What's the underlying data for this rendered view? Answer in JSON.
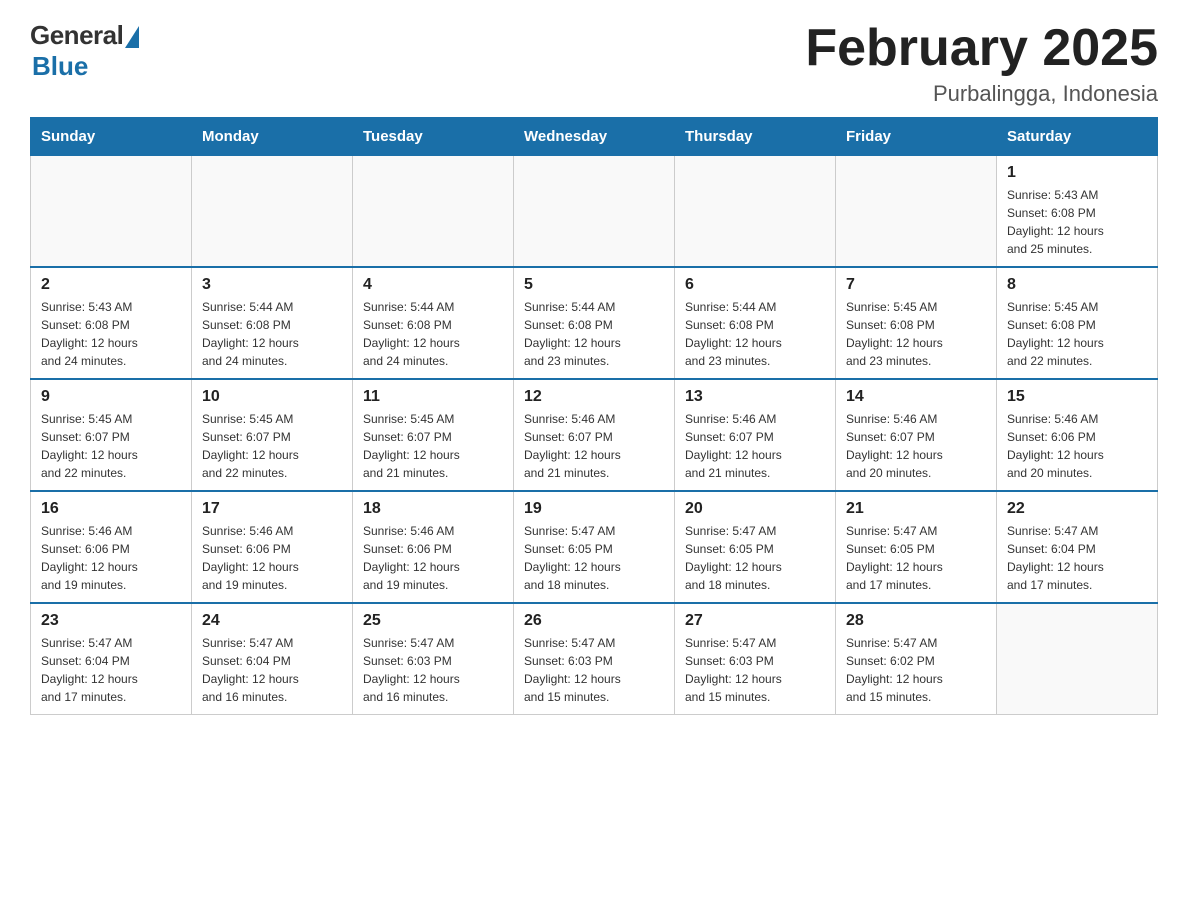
{
  "header": {
    "logo_general": "General",
    "logo_blue": "Blue",
    "title": "February 2025",
    "subtitle": "Purbalingga, Indonesia"
  },
  "weekdays": [
    "Sunday",
    "Monday",
    "Tuesday",
    "Wednesday",
    "Thursday",
    "Friday",
    "Saturday"
  ],
  "weeks": [
    [
      {
        "day": "",
        "info": ""
      },
      {
        "day": "",
        "info": ""
      },
      {
        "day": "",
        "info": ""
      },
      {
        "day": "",
        "info": ""
      },
      {
        "day": "",
        "info": ""
      },
      {
        "day": "",
        "info": ""
      },
      {
        "day": "1",
        "info": "Sunrise: 5:43 AM\nSunset: 6:08 PM\nDaylight: 12 hours\nand 25 minutes."
      }
    ],
    [
      {
        "day": "2",
        "info": "Sunrise: 5:43 AM\nSunset: 6:08 PM\nDaylight: 12 hours\nand 24 minutes."
      },
      {
        "day": "3",
        "info": "Sunrise: 5:44 AM\nSunset: 6:08 PM\nDaylight: 12 hours\nand 24 minutes."
      },
      {
        "day": "4",
        "info": "Sunrise: 5:44 AM\nSunset: 6:08 PM\nDaylight: 12 hours\nand 24 minutes."
      },
      {
        "day": "5",
        "info": "Sunrise: 5:44 AM\nSunset: 6:08 PM\nDaylight: 12 hours\nand 23 minutes."
      },
      {
        "day": "6",
        "info": "Sunrise: 5:44 AM\nSunset: 6:08 PM\nDaylight: 12 hours\nand 23 minutes."
      },
      {
        "day": "7",
        "info": "Sunrise: 5:45 AM\nSunset: 6:08 PM\nDaylight: 12 hours\nand 23 minutes."
      },
      {
        "day": "8",
        "info": "Sunrise: 5:45 AM\nSunset: 6:08 PM\nDaylight: 12 hours\nand 22 minutes."
      }
    ],
    [
      {
        "day": "9",
        "info": "Sunrise: 5:45 AM\nSunset: 6:07 PM\nDaylight: 12 hours\nand 22 minutes."
      },
      {
        "day": "10",
        "info": "Sunrise: 5:45 AM\nSunset: 6:07 PM\nDaylight: 12 hours\nand 22 minutes."
      },
      {
        "day": "11",
        "info": "Sunrise: 5:45 AM\nSunset: 6:07 PM\nDaylight: 12 hours\nand 21 minutes."
      },
      {
        "day": "12",
        "info": "Sunrise: 5:46 AM\nSunset: 6:07 PM\nDaylight: 12 hours\nand 21 minutes."
      },
      {
        "day": "13",
        "info": "Sunrise: 5:46 AM\nSunset: 6:07 PM\nDaylight: 12 hours\nand 21 minutes."
      },
      {
        "day": "14",
        "info": "Sunrise: 5:46 AM\nSunset: 6:07 PM\nDaylight: 12 hours\nand 20 minutes."
      },
      {
        "day": "15",
        "info": "Sunrise: 5:46 AM\nSunset: 6:06 PM\nDaylight: 12 hours\nand 20 minutes."
      }
    ],
    [
      {
        "day": "16",
        "info": "Sunrise: 5:46 AM\nSunset: 6:06 PM\nDaylight: 12 hours\nand 19 minutes."
      },
      {
        "day": "17",
        "info": "Sunrise: 5:46 AM\nSunset: 6:06 PM\nDaylight: 12 hours\nand 19 minutes."
      },
      {
        "day": "18",
        "info": "Sunrise: 5:46 AM\nSunset: 6:06 PM\nDaylight: 12 hours\nand 19 minutes."
      },
      {
        "day": "19",
        "info": "Sunrise: 5:47 AM\nSunset: 6:05 PM\nDaylight: 12 hours\nand 18 minutes."
      },
      {
        "day": "20",
        "info": "Sunrise: 5:47 AM\nSunset: 6:05 PM\nDaylight: 12 hours\nand 18 minutes."
      },
      {
        "day": "21",
        "info": "Sunrise: 5:47 AM\nSunset: 6:05 PM\nDaylight: 12 hours\nand 17 minutes."
      },
      {
        "day": "22",
        "info": "Sunrise: 5:47 AM\nSunset: 6:04 PM\nDaylight: 12 hours\nand 17 minutes."
      }
    ],
    [
      {
        "day": "23",
        "info": "Sunrise: 5:47 AM\nSunset: 6:04 PM\nDaylight: 12 hours\nand 17 minutes."
      },
      {
        "day": "24",
        "info": "Sunrise: 5:47 AM\nSunset: 6:04 PM\nDaylight: 12 hours\nand 16 minutes."
      },
      {
        "day": "25",
        "info": "Sunrise: 5:47 AM\nSunset: 6:03 PM\nDaylight: 12 hours\nand 16 minutes."
      },
      {
        "day": "26",
        "info": "Sunrise: 5:47 AM\nSunset: 6:03 PM\nDaylight: 12 hours\nand 15 minutes."
      },
      {
        "day": "27",
        "info": "Sunrise: 5:47 AM\nSunset: 6:03 PM\nDaylight: 12 hours\nand 15 minutes."
      },
      {
        "day": "28",
        "info": "Sunrise: 5:47 AM\nSunset: 6:02 PM\nDaylight: 12 hours\nand 15 minutes."
      },
      {
        "day": "",
        "info": ""
      }
    ]
  ]
}
